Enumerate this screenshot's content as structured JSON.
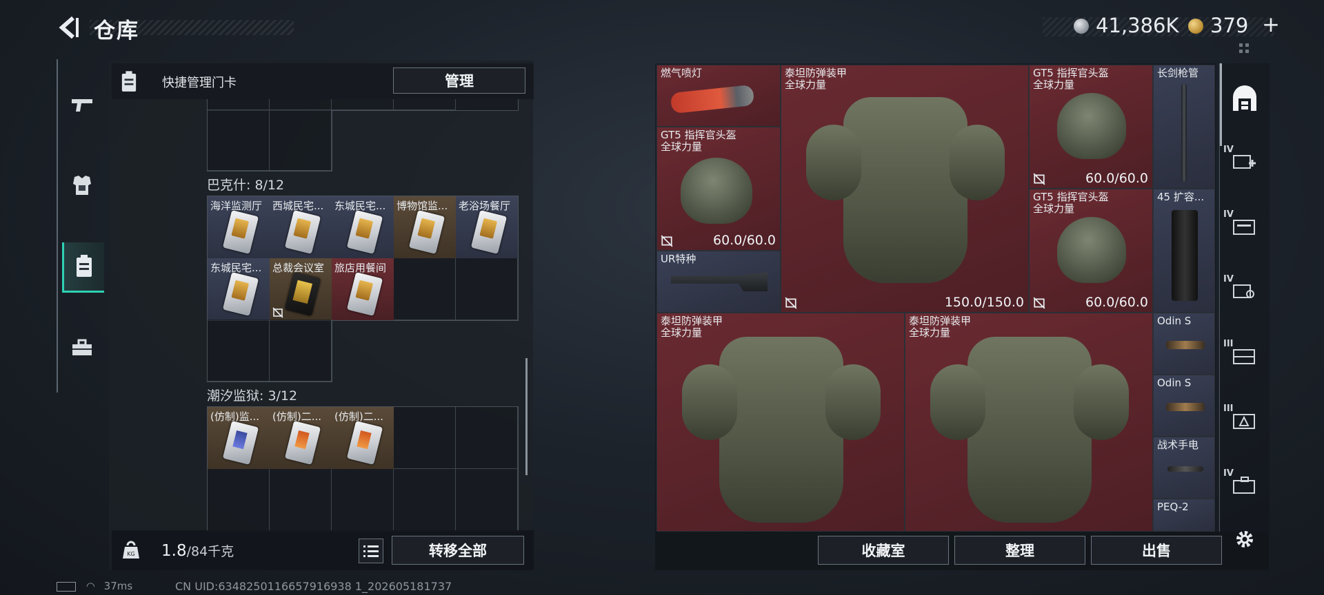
{
  "header": {
    "title": "仓库",
    "currency1": "41,386K",
    "currency2": "379",
    "plus": "+"
  },
  "rail": {
    "items": [
      "weapons-icon",
      "armor-icon",
      "keycard-icon",
      "toolbox-icon"
    ],
    "selected": "keycard-icon"
  },
  "left_panel": {
    "header_label": "快捷管理门卡",
    "manage_button": "管理",
    "sections": [
      {
        "title": "巴克什: 8/12",
        "cards": [
          {
            "name": "海洋监测厅",
            "color": "blue"
          },
          {
            "name": "西城民宅...",
            "color": "blue"
          },
          {
            "name": "东城民宅...",
            "color": "blue"
          },
          {
            "name": "博物馆监...",
            "color": "brown"
          },
          {
            "name": "老浴场餐厅",
            "color": "blue"
          },
          {
            "name": "东城民宅...",
            "color": "blue"
          },
          {
            "name": "总裁会议室",
            "color": "brown"
          },
          {
            "name": "旅店用餐间",
            "color": "red"
          }
        ]
      },
      {
        "title": "潮汐监狱: 3/12",
        "cards": [
          {
            "name": "(仿制)监...",
            "color": "brown"
          },
          {
            "name": "(仿制)二...",
            "color": "brown"
          },
          {
            "name": "(仿制)二...",
            "color": "brown"
          }
        ]
      }
    ],
    "weight_value": "1.8",
    "weight_unit": "/84千克",
    "transfer_button": "转移全部"
  },
  "right_panel": {
    "items": [
      {
        "name": "燃气喷灯",
        "sub": ""
      },
      {
        "name": "泰坦防弹装甲",
        "sub": "全球力量",
        "durability": "150.0/150.0"
      },
      {
        "name": "GT5 指挥官头盔",
        "sub": "全球力量",
        "durability": "60.0/60.0"
      },
      {
        "name": "长剑枪管",
        "sub": ""
      },
      {
        "name": "GT5 指挥官头盔",
        "sub": "全球力量",
        "durability": "60.0/60.0"
      },
      {
        "name": "GT5 指挥官头盔",
        "sub": "全球力量",
        "durability": "60.0/60.0"
      },
      {
        "name": "45 扩容...",
        "sub": ""
      },
      {
        "name": "UR特种",
        "sub": ""
      },
      {
        "name": "泰坦防弹装甲",
        "sub": "全球力量"
      },
      {
        "name": "泰坦防弹装甲",
        "sub": "全球力量"
      },
      {
        "name": "Odin S",
        "sub": ""
      },
      {
        "name": "Odin S",
        "sub": ""
      },
      {
        "name": "战术手电",
        "sub": ""
      },
      {
        "name": "PEQ-2",
        "sub": ""
      }
    ],
    "buttons": {
      "collection": "收藏室",
      "sort": "整理",
      "sell": "出售"
    }
  },
  "right_rail": {
    "tiers": [
      "IV",
      "IV",
      "IV",
      "III",
      "III",
      "IV"
    ]
  },
  "status": {
    "ping": "37ms",
    "uid": "CN UID:6348250116657916938 1_202605181737"
  }
}
